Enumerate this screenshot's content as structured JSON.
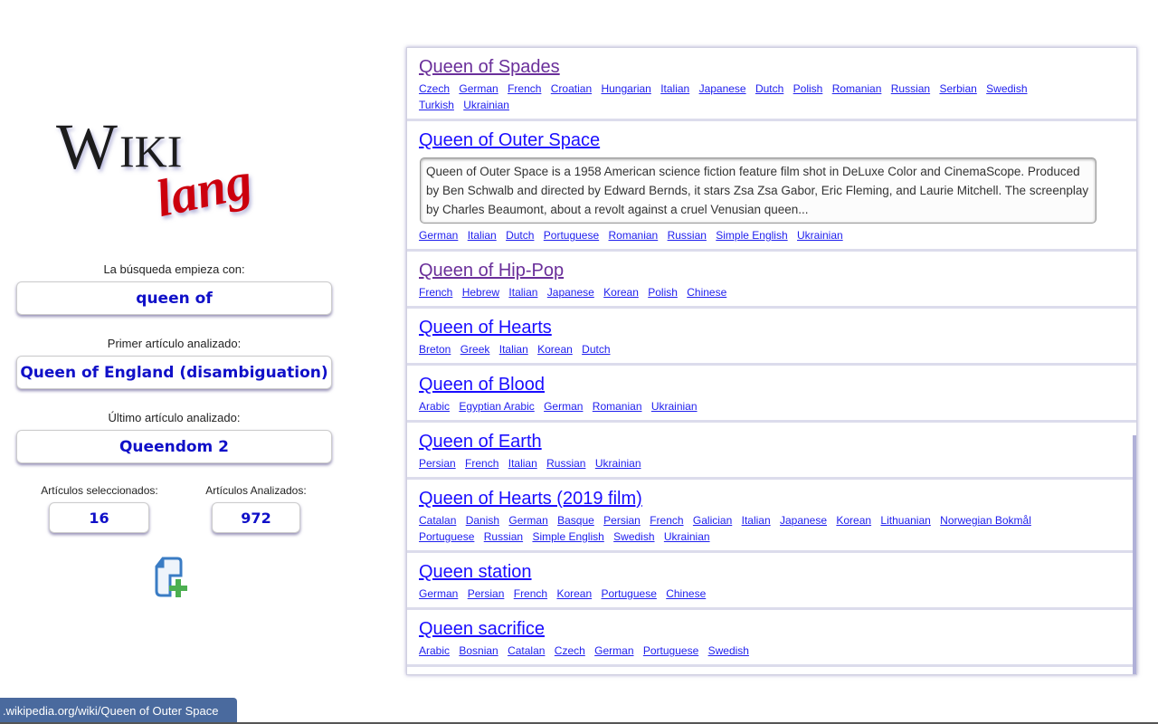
{
  "logo": {
    "text_main": "WIKI",
    "text_script": "lang"
  },
  "sidebar": {
    "search_label": "La búsqueda empieza con:",
    "search_value": "queen of",
    "first_label": "Primer artículo analizado:",
    "first_value": "Queen of England (disambiguation)",
    "last_label": "Último artículo analizado:",
    "last_value": "Queendom 2",
    "selected_label": "Artículos seleccionados:",
    "selected_value": "16",
    "analyzed_label": "Artículos Analizados:",
    "analyzed_value": "972",
    "add_icon": "document-add-icon"
  },
  "results": [
    {
      "title": "Queen of Spades",
      "visited": true,
      "langs": [
        "Czech",
        "German",
        "French",
        "Croatian",
        "Hungarian",
        "Italian",
        "Japanese",
        "Dutch",
        "Polish",
        "Romanian",
        "Russian",
        "Serbian",
        "Swedish",
        "Turkish",
        "Ukrainian"
      ]
    },
    {
      "title": "Queen of Outer Space",
      "visited": false,
      "description": "Queen of Outer Space is a 1958 American science fiction feature film shot in DeLuxe Color and CinemaScope. Produced by Ben Schwalb and directed by Edward Bernds, it stars Zsa Zsa Gabor, Eric Fleming, and Laurie Mitchell. The screenplay by Charles Beaumont, about a revolt against a cruel Venusian queen...",
      "langs": [
        "German",
        "Italian",
        "Dutch",
        "Portuguese",
        "Romanian",
        "Russian",
        "Simple English",
        "Ukrainian"
      ]
    },
    {
      "title": "Queen of Hip-Pop",
      "visited": true,
      "langs": [
        "French",
        "Hebrew",
        "Italian",
        "Japanese",
        "Korean",
        "Polish",
        "Chinese"
      ]
    },
    {
      "title": "Queen of Hearts",
      "visited": false,
      "langs": [
        "Breton",
        "Greek",
        "Italian",
        "Korean",
        "Dutch"
      ]
    },
    {
      "title": "Queen of Blood",
      "visited": false,
      "langs": [
        "Arabic",
        "Egyptian Arabic",
        "German",
        "Romanian",
        "Ukrainian"
      ]
    },
    {
      "title": "Queen of Earth",
      "visited": false,
      "langs": [
        "Persian",
        "French",
        "Italian",
        "Russian",
        "Ukrainian"
      ]
    },
    {
      "title": "Queen of Hearts (2019 film)",
      "visited": false,
      "langs": [
        "Catalan",
        "Danish",
        "German",
        "Basque",
        "Persian",
        "French",
        "Galician",
        "Italian",
        "Japanese",
        "Korean",
        "Lithuanian",
        "Norwegian Bokmål",
        "Portuguese",
        "Russian",
        "Simple English",
        "Swedish",
        "Ukrainian"
      ]
    },
    {
      "title": "Queen station",
      "visited": false,
      "langs": [
        "German",
        "Persian",
        "French",
        "Korean",
        "Portuguese",
        "Chinese"
      ]
    },
    {
      "title": "Queen sacrifice",
      "visited": false,
      "langs": [
        "Arabic",
        "Bosnian",
        "Catalan",
        "Czech",
        "German",
        "Portuguese",
        "Swedish"
      ]
    }
  ],
  "status_bar": {
    "url": ".wikipedia.org/wiki/Queen of Outer Space"
  },
  "colors": {
    "link": "#1a0dff",
    "visited": "#6a2f9a",
    "value_text": "#1010c8",
    "logo_red": "#cc0011",
    "status_bg": "#4a6a9e"
  }
}
